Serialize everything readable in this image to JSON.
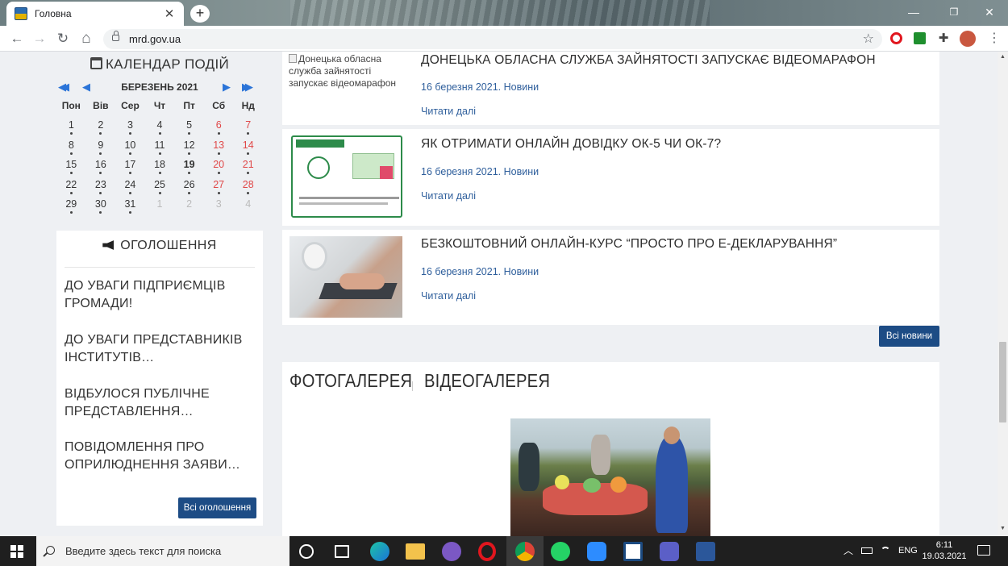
{
  "browser": {
    "tab_title": "Головна",
    "tab_close": "✕",
    "new_tab": "+",
    "url": "mrd.gov.ua",
    "window_controls": [
      "—",
      "❐",
      "✕"
    ],
    "nav": {
      "back": "←",
      "forward": "→",
      "reload": "↻",
      "home": "⌂"
    },
    "star": "☆",
    "extensions": [
      "opera-icon",
      "green-extension-icon",
      "puzzle-icon",
      "profile-avatar",
      "menu-icon"
    ]
  },
  "calendar": {
    "title": "КАЛЕНДАР ПОДІЙ",
    "month": "БЕРЕЗЕНЬ 2021",
    "nav": {
      "prev_year": "◀◀",
      "prev": "◀",
      "next": "▶",
      "next_year": "▶▶"
    },
    "weekdays": [
      "Пон",
      "Вів",
      "Сер",
      "Чт",
      "Пт",
      "Сб",
      "Нд"
    ],
    "weeks": [
      [
        "1",
        "2",
        "3",
        "4",
        "5",
        "6",
        "7"
      ],
      [
        "8",
        "9",
        "10",
        "11",
        "12",
        "13",
        "14"
      ],
      [
        "15",
        "16",
        "17",
        "18",
        "19",
        "20",
        "21"
      ],
      [
        "22",
        "23",
        "24",
        "25",
        "26",
        "27",
        "28"
      ],
      [
        "29",
        "30",
        "31",
        "1",
        "2",
        "3",
        "4"
      ]
    ],
    "today": "19"
  },
  "announcements": {
    "title": "ОГОЛОШЕННЯ",
    "items": [
      "ДО УВАГИ ПІДПРИЄМЦІВ ГРОМАДИ!",
      "ДО УВАГИ ПРЕДСТАВНИКІВ ІНСТИТУТІВ…",
      "ВІДБУЛОСЯ ПУБЛІЧНЕ ПРЕДСТАВЛЕННЯ…",
      "ПОВІДОМЛЕННЯ ПРО ОПРИЛЮДНЕННЯ ЗАЯВИ…"
    ],
    "all_button": "Всі оголошення"
  },
  "news": {
    "items": [
      {
        "title": "ДОНЕЦЬКА ОБЛАСНА СЛУЖБА ЗАЙНЯТОСТІ ЗАПУСКАЄ ВІДЕОМАРАФОН",
        "date": "16 березня 2021. Новини",
        "more": "Читати далі",
        "image_alt": "Донецька обласна служба зайнятості запускає відеомарафон"
      },
      {
        "title": "ЯК ОТРИМАТИ ОНЛАЙН ДОВІДКУ ОК-5 ЧИ ОК-7?",
        "date": "16 березня 2021. Новини",
        "more": "Читати далі"
      },
      {
        "title": "БЕЗКОШТОВНИЙ ОНЛАЙН-КУРС “ПРОСТО ПРО Е-ДЕКЛАРУВАННЯ”",
        "date": "16 березня 2021. Новини",
        "more": "Читати далі"
      }
    ],
    "all_button": "Всі новини"
  },
  "gallery": {
    "tabs": [
      "ФОТОГАЛЕРЕЯ",
      "ВІДЕОГАЛЕРЕЯ"
    ],
    "separator": "|"
  },
  "taskbar": {
    "search_placeholder": "Введите здесь текст для поиска",
    "tray_chevron": "︿",
    "language": "ENG",
    "time": "6:11",
    "date": "19.03.2021"
  },
  "colors": {
    "accent_blue": "#1d4c85",
    "link_blue": "#2f5f9c",
    "weekend_red": "#e04848"
  }
}
